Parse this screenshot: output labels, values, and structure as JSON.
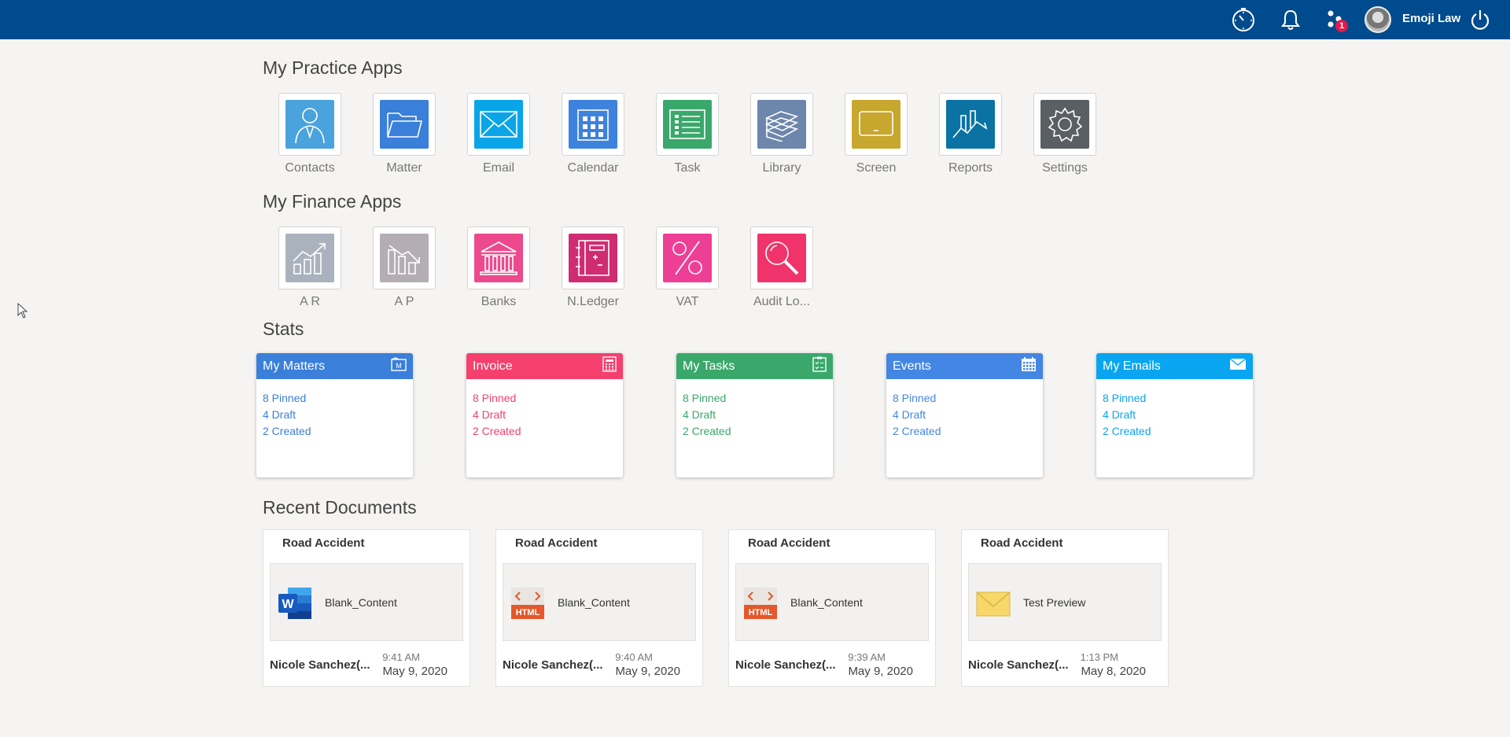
{
  "header": {
    "user_name": "Emoji Law",
    "notification_badge": "1",
    "bar_color": "#004b8d"
  },
  "practice": {
    "title": "My Practice Apps",
    "apps": [
      {
        "label": "Contacts",
        "color": "#4aa3dc",
        "icon": "person-icon"
      },
      {
        "label": "Matter",
        "color": "#3a7fd9",
        "icon": "folder-icon"
      },
      {
        "label": "Email",
        "color": "#0aa5e8",
        "icon": "envelope-icon"
      },
      {
        "label": "Calendar",
        "color": "#3d82dd",
        "icon": "calendar-icon"
      },
      {
        "label": "Task",
        "color": "#3aa86b",
        "icon": "task-list-icon"
      },
      {
        "label": "Library",
        "color": "#6d86ab",
        "icon": "books-icon"
      },
      {
        "label": "Screen",
        "color": "#c8a72e",
        "icon": "monitor-icon"
      },
      {
        "label": "Reports",
        "color": "#0b73a4",
        "icon": "chart-icon"
      },
      {
        "label": "Settings",
        "color": "#5a5f63",
        "icon": "gear-icon"
      }
    ]
  },
  "finance": {
    "title": "My Finance Apps",
    "apps": [
      {
        "label": "A R",
        "color": "#aab2bd",
        "icon": "chart-up-icon"
      },
      {
        "label": "A P",
        "color": "#b4aeb4",
        "icon": "chart-down-icon"
      },
      {
        "label": "Banks",
        "color": "#ec4a8c",
        "icon": "bank-icon"
      },
      {
        "label": "N.Ledger",
        "color": "#d02c72",
        "icon": "ledger-icon"
      },
      {
        "label": "VAT",
        "color": "#ee3f96",
        "icon": "percent-icon"
      },
      {
        "label": "Audit Lo...",
        "color": "#f0346b",
        "icon": "magnifier-icon"
      }
    ]
  },
  "stats": {
    "title": "Stats",
    "cards": [
      {
        "title": "My Matters",
        "color": "#3a7fd9",
        "text_color": "#3a7fd9",
        "pinned": "8 Pinned",
        "draft": "4 Draft",
        "created": "2 Created"
      },
      {
        "title": "Invoice",
        "color": "#f5406e",
        "text_color": "#f5406e",
        "pinned": "8 Pinned",
        "draft": "4 Draft",
        "created": "2 Created"
      },
      {
        "title": "My Tasks",
        "color": "#3aa86b",
        "text_color": "#3aa86b",
        "pinned": "8 Pinned",
        "draft": "4 Draft",
        "created": "2 Created"
      },
      {
        "title": "Events",
        "color": "#4486e3",
        "text_color": "#4486e3",
        "pinned": "8 Pinned",
        "draft": "4 Draft",
        "created": "2 Created"
      },
      {
        "title": "My Emails",
        "color": "#0aa5f0",
        "text_color": "#0aa5f0",
        "pinned": "8 Pinned",
        "draft": "4 Draft",
        "created": "2 Created"
      }
    ]
  },
  "documents": {
    "title": "Recent Documents",
    "items": [
      {
        "matter": "Road Accident",
        "name": "Blank_Content",
        "type": "word-icon",
        "user": "Nicole Sanchez(...",
        "time": "9:41 AM",
        "date": "May 9, 2020"
      },
      {
        "matter": "Road Accident",
        "name": "Blank_Content",
        "type": "html-icon",
        "user": "Nicole Sanchez(...",
        "time": "9:40 AM",
        "date": "May 9, 2020"
      },
      {
        "matter": "Road Accident",
        "name": "Blank_Content",
        "type": "html-icon",
        "user": "Nicole Sanchez(...",
        "time": "9:39 AM",
        "date": "May 9, 2020"
      },
      {
        "matter": "Road Accident",
        "name": "Test Preview",
        "type": "email-icon",
        "user": "Nicole Sanchez(...",
        "time": "1:13 PM",
        "date": "May 8, 2020"
      }
    ]
  }
}
